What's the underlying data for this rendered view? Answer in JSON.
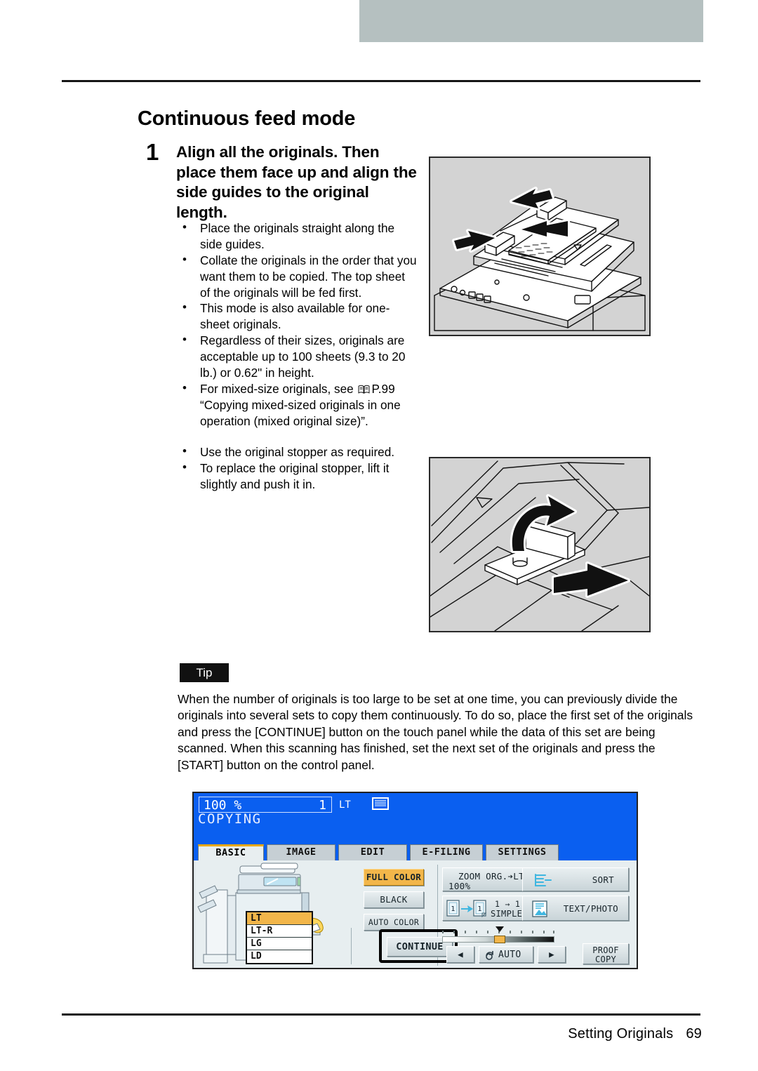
{
  "page": {
    "chapter_title": "Continuous feed mode",
    "footer_section": "Setting Originals",
    "footer_page": "69",
    "header_band_color": "#b5c0c0"
  },
  "step": {
    "number": "1",
    "title": "Align all the originals. Then place them face up and align the side guides to the original length.",
    "bullets": [
      "Place the originals straight along the side guides.",
      "Collate the originals in the order that you want them to be copied. The top sheet of the originals will be fed first.",
      "This mode is also available for one-sheet originals.",
      "Regardless of their sizes, originals are acceptable up to 100 sheets (9.3 to 20 lb.) or 0.62\" in height.",
      "For mixed-size originals, see ",
      "P.99 “Copying mixed-sized originals in one operation (mixed original size)”.",
      "Use the original stopper as required.",
      "To replace the original stopper, lift it slightly and push it in."
    ]
  },
  "illustrations": {
    "feeder_caption": "document-feeder-with-side-guides",
    "stopper_caption": "original-stopper-lift-and-push"
  },
  "tip": {
    "badge": "Tip",
    "body": "When the number of originals is too large to be set at one time, you can previously divide the originals into several sets to copy them continuously. To do so, place the first set of the originals and press the [CONTINUE] button on the touch panel while the data of this set are being scanned. When this scanning has finished, set the next set of the originals and press the [START] button on the control panel."
  },
  "touch_panel": {
    "status": {
      "zoom": "100  %",
      "zoom_unit": "%",
      "copies": "1",
      "paper_size": "LT",
      "state": "COPYING"
    },
    "tabs": [
      {
        "label": "BASIC",
        "active": true
      },
      {
        "label": "IMAGE",
        "active": false
      },
      {
        "label": "EDIT",
        "active": false
      },
      {
        "label": "E-FILING",
        "active": false
      },
      {
        "label": "SETTINGS",
        "active": false
      }
    ],
    "paper_sources": [
      {
        "label": "LT",
        "selected": true
      },
      {
        "label": "LT-R",
        "selected": false
      },
      {
        "label": "LG",
        "selected": false
      },
      {
        "label": "LD",
        "selected": false
      }
    ],
    "color_modes": [
      {
        "label": "FULL COLOR",
        "selected": true
      },
      {
        "label": "BLACK",
        "selected": false
      },
      {
        "label": "AUTO COLOR",
        "selected": false
      }
    ],
    "continue_button": "CONTINUE",
    "zoom_button": {
      "line1": "ZOOM  ORG.➔LT",
      "line2": "100%"
    },
    "duplex_button": {
      "line1": "1 → 1",
      "line2": "SIMPLEX",
      "icon_digit": "1"
    },
    "sort_button": "SORT",
    "original_mode_button": "TEXT/PHOTO",
    "density": {
      "auto_label": "AUTO",
      "left_arrow": "◀",
      "right_arrow": "▶"
    },
    "proof_copy_button": {
      "line1": "PROOF",
      "line2": "COPY"
    }
  }
}
